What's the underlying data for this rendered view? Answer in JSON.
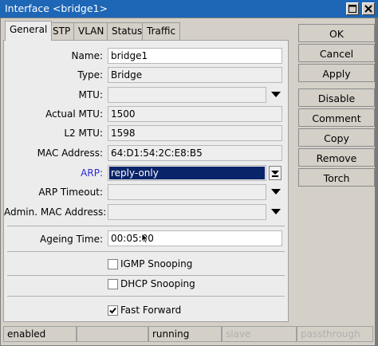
{
  "window": {
    "title": "Interface <bridge1>"
  },
  "tabs": [
    {
      "label": "General",
      "active": true
    },
    {
      "label": "STP"
    },
    {
      "label": "VLAN"
    },
    {
      "label": "Status"
    },
    {
      "label": "Traffic"
    }
  ],
  "form": {
    "name": {
      "label": "Name:",
      "value": "bridge1"
    },
    "type": {
      "label": "Type:",
      "value": "Bridge"
    },
    "mtu": {
      "label": "MTU:",
      "value": ""
    },
    "actual_mtu": {
      "label": "Actual MTU:",
      "value": "1500"
    },
    "l2_mtu": {
      "label": "L2 MTU:",
      "value": "1598"
    },
    "mac_address": {
      "label": "MAC Address:",
      "value": "64:D1:54:2C:E8:B5"
    },
    "arp": {
      "label": "ARP:",
      "value": "reply-only"
    },
    "arp_timeout": {
      "label": "ARP Timeout:",
      "value": ""
    },
    "admin_mac": {
      "label": "Admin. MAC Address:",
      "value": ""
    },
    "ageing_time": {
      "label": "Ageing Time:",
      "value": "00:05:00"
    },
    "igmp_snooping": {
      "label": "IGMP Snooping",
      "checked": false
    },
    "dhcp_snooping": {
      "label": "DHCP Snooping",
      "checked": false
    },
    "fast_forward": {
      "label": "Fast Forward",
      "checked": true
    }
  },
  "buttons": {
    "ok": "OK",
    "cancel": "Cancel",
    "apply": "Apply",
    "disable": "Disable",
    "comment": "Comment",
    "copy": "Copy",
    "remove": "Remove",
    "torch": "Torch"
  },
  "statusbar": {
    "s1": "enabled",
    "s2": "",
    "s3": "running",
    "s4": "slave",
    "s5": "passthrough"
  },
  "colors": {
    "titlebar": "#1e66b6",
    "arp_label": "#2a2ad6",
    "selection": "#0a246a"
  }
}
